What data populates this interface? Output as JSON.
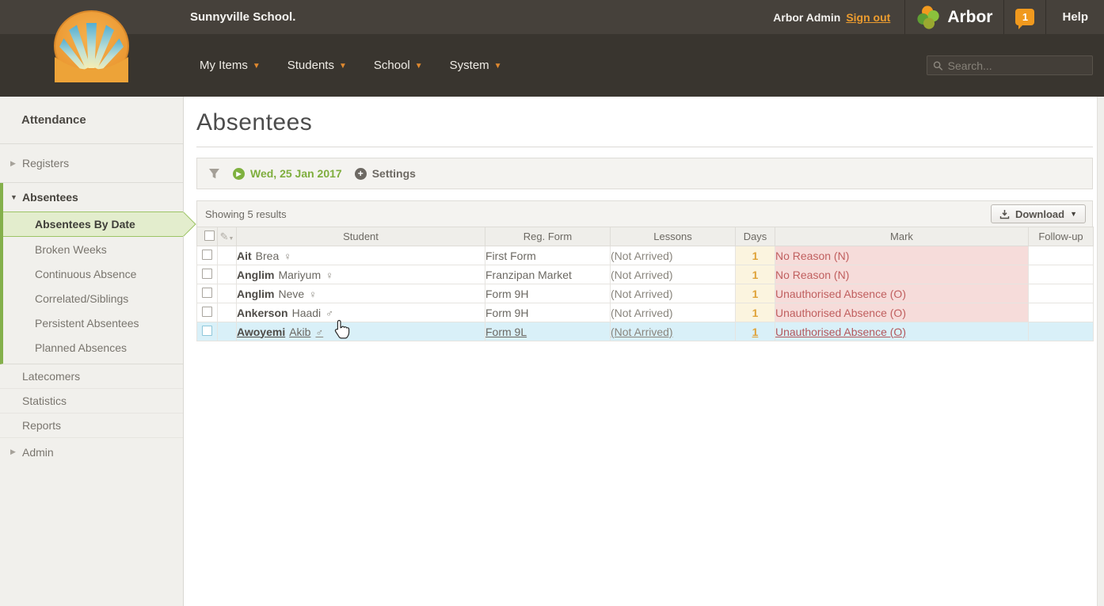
{
  "topbar": {
    "school_name": "Sunnyville School.",
    "user_name": "Arbor Admin",
    "sign_out_label": "Sign out",
    "brand_label": "Arbor",
    "notification_count": "1",
    "help_label": "Help"
  },
  "navbar": {
    "items": [
      {
        "label": "My Items"
      },
      {
        "label": "Students"
      },
      {
        "label": "School"
      },
      {
        "label": "System"
      }
    ],
    "search_placeholder": "Search..."
  },
  "sidebar": {
    "title": "Attendance",
    "items": [
      {
        "label": "Registers"
      },
      {
        "label": "Absentees"
      },
      {
        "label": "Absentees By Date",
        "selected": true
      },
      {
        "label": "Broken Weeks"
      },
      {
        "label": "Continuous Absence"
      },
      {
        "label": "Correlated/Siblings"
      },
      {
        "label": "Persistent Absentees"
      },
      {
        "label": "Planned Absences"
      },
      {
        "label": "Latecomers"
      },
      {
        "label": "Statistics"
      },
      {
        "label": "Reports"
      },
      {
        "label": "Admin"
      }
    ]
  },
  "main": {
    "page_title": "Absentees",
    "filter": {
      "date": "Wed, 25 Jan 2017",
      "settings_label": "Settings"
    },
    "results_summary": "Showing 5 results",
    "download_label": "Download",
    "table": {
      "columns": [
        "Student",
        "Reg. Form",
        "Lessons",
        "Days",
        "Mark",
        "Follow-up"
      ],
      "rows": [
        {
          "last_name": "Ait",
          "first_name": "Brea",
          "gender_symbol": "♀",
          "reg_form": "First Form",
          "lessons": "(Not Arrived)",
          "days": "1",
          "mark": "No Reason (N)",
          "follow_up": ""
        },
        {
          "last_name": "Anglim",
          "first_name": "Mariyum",
          "gender_symbol": "♀",
          "reg_form": "Franzipan Market",
          "lessons": "(Not Arrived)",
          "days": "1",
          "mark": "No Reason (N)",
          "follow_up": ""
        },
        {
          "last_name": "Anglim",
          "first_name": "Neve",
          "gender_symbol": "♀",
          "reg_form": "Form 9H",
          "lessons": "(Not Arrived)",
          "days": "1",
          "mark": "Unauthorised Absence (O)",
          "follow_up": ""
        },
        {
          "last_name": "Ankerson",
          "first_name": "Haadi",
          "gender_symbol": "♂",
          "reg_form": "Form 9H",
          "lessons": "(Not Arrived)",
          "days": "1",
          "mark": "Unauthorised Absence (O)",
          "follow_up": ""
        },
        {
          "last_name": "Awoyemi",
          "first_name": "Akib",
          "gender_symbol": "♂",
          "reg_form": "Form 9L",
          "lessons": "(Not Arrived)",
          "days": "1",
          "mark": "Unauthorised Absence (O)",
          "follow_up": "",
          "hovered": true
        }
      ]
    }
  },
  "colors": {
    "topbar_bg": "#46413b",
    "navbar_bg": "#39352f",
    "accent_orange": "#ec9c2f",
    "accent_green": "#7fae3e",
    "selected_item_bg": "#e3edcd",
    "days_text": "#dfa339",
    "days_bg": "#fbf4df",
    "mark_text": "#c05f5f",
    "mark_bg": "#f6dcda",
    "hover_row_bg": "#d9f0f8"
  }
}
